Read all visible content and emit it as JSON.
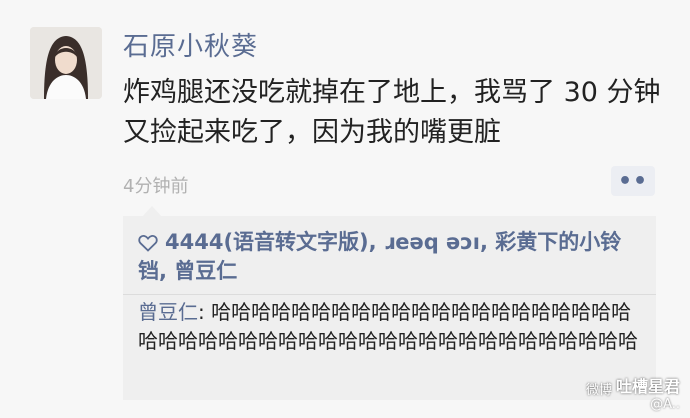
{
  "post": {
    "username": "石原小秋葵",
    "text": "炸鸡腿还没吃就掉在了地上，我骂了 30 分钟又捡起来吃了，因为我的嘴更脏",
    "time": "4分钟前",
    "more_button_label": "••"
  },
  "interactions": {
    "likes_text": "4444(语音转文字版), ɹeǝq ǝɔı, 彩黄下的小铃铛, 曾豆仁",
    "comments": [
      {
        "author": "曾豆仁",
        "separator": ": ",
        "text": "哈哈哈哈哈哈哈哈哈哈哈哈哈哈哈哈哈哈哈哈哈哈哈哈哈哈哈哈哈哈哈哈哈哈哈哈哈哈哈哈哈哈哈哈哈哈"
      }
    ]
  },
  "watermark": {
    "logo": "微博",
    "main": "吐槽星君",
    "sub": "@A.."
  },
  "colors": {
    "link": "#5a6c92",
    "text": "#222222",
    "time": "#b1b1b1",
    "box_background": "#efefef",
    "page_background": "#f7f7f7"
  }
}
